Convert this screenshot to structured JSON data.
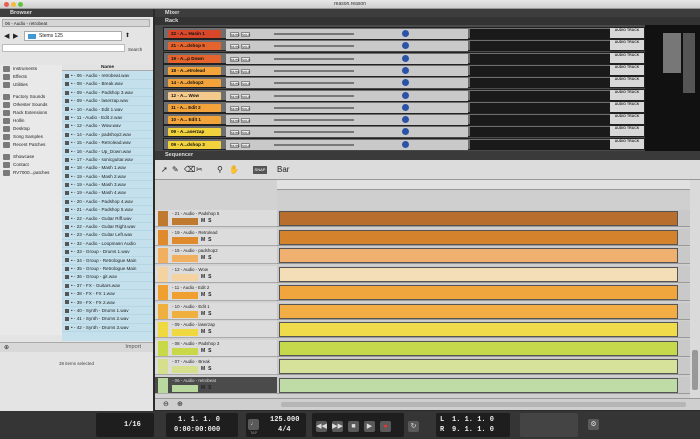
{
  "window": {
    "title": "reason.reason"
  },
  "browser": {
    "header": "Browser",
    "source_path": "06 - Audio - retrobeat",
    "location": "Stems 125",
    "search_label": "Search",
    "list_header": "Name",
    "locations": [
      "Instruments",
      "Effects",
      "Utilities",
      "Factory Sounds",
      "Orkester Sounds",
      "Rack Extensions",
      "Hollin",
      "Desktop",
      "Song Samples",
      "Recent Patches",
      "Showcase",
      "Contact",
      "RV7000...patches"
    ],
    "files": [
      "• - 06 - Audio - retrobeat.wav",
      "• - 08 - Audio - Break.wav",
      "• - 09 - Audio - Padshop 3.wav",
      "• - 09 - Audio - laserzap.wav",
      "• - 10 - Audio - Edit 1.wav",
      "• - 11 - Audio - Edit 2.wav",
      "• - 12 - Audio - Wow.wav",
      "• - 14 - Audio - padshop2.wav",
      "• - 15 - Audio - Retrolead.wav",
      "• - 16 - Audio - Up_Down.wav",
      "• - 17 - Audio - sonicguitar.wav",
      "• - 18 - Audio - Mash 1.wav",
      "• - 19 - Audio - Mash 2.wav",
      "• - 19 - Audio - Mash 3.wav",
      "• - 19 - Audio - Mash 4.wav",
      "• - 20 - Audio - Padshop 4.wav",
      "• - 21 - Audio - Padshop 5.wav",
      "• - 22 - Audio - Guitar Riff.wav",
      "• - 22 - Audio - Guitar Right.wav",
      "• - 23 - Audio - Guitar Left.wav",
      "• - 32 - Audio - Loopmasn Audio",
      "• - 33 - Group - Drums 1.wav",
      "• - 34 - Group - Retrologue Main",
      "• - 35 - Group - Retrologue Main",
      "• - 36 - Group - git.wav",
      "• - 37 - FX - Guitars.wav",
      "• - 38 - FX - FX 1.wav",
      "• - 39 - FX - FX 2.wav",
      "• - 40 - Synth - Drums 1.wav",
      "• - 41 - Synth - Drums 2.wav",
      "• - 42 - Synth - Drums 3.wav"
    ],
    "import_label": "Import",
    "selection_count": "38 items selected"
  },
  "mixer": {
    "header": "Mixer"
  },
  "rack": {
    "header": "Rack",
    "track_tag": "AUDIO TRACK",
    "mute_label": "MUTE",
    "solo_label": "SOLO",
    "rows": [
      {
        "name": "22 - A... Hasin 1",
        "color": "#d9472b"
      },
      {
        "name": "21 - A...dshop 5",
        "color": "#e5632c"
      },
      {
        "name": "19 - A...p Down",
        "color": "#e5632c"
      },
      {
        "name": "18 - A...etrolead",
        "color": "#f2a43a"
      },
      {
        "name": "14 - A...dshop2",
        "color": "#f2a43a"
      },
      {
        "name": "12 - A... Wow",
        "color": "#f4c98c"
      },
      {
        "name": "11 - A... Edit 2",
        "color": "#f2a43a"
      },
      {
        "name": "10 - A... Edit 1",
        "color": "#f2a43a"
      },
      {
        "name": "09 - A...aserzap",
        "color": "#f1d23c"
      },
      {
        "name": "09 - A...dshop 3",
        "color": "#f1d23c"
      }
    ]
  },
  "sequencer": {
    "header": "Sequencer",
    "snap_label": "SNAP",
    "snap_value": "Bar",
    "tracks": [
      {
        "name": "- 21 - Audio - Padshop 5",
        "color": "#c07a30",
        "lane": "#b86e2c"
      },
      {
        "name": "- 19 - Audio - Retrolead",
        "color": "#e08a2e",
        "lane": "#d4832c"
      },
      {
        "name": "- 15 - Audio - padshop2",
        "color": "#f0b060",
        "lane": "#f0b070"
      },
      {
        "name": "- 12 - Audio - Wow",
        "color": "#f4d3a0",
        "lane": "#f3deb8"
      },
      {
        "name": "- 11 - Audio - Edit 2",
        "color": "#f0a030",
        "lane": "#f0a63c"
      },
      {
        "name": "- 10 - Audio - Edit 1",
        "color": "#f0b040",
        "lane": "#f2ae44"
      },
      {
        "name": "- 09 - Audio - laserzap",
        "color": "#efd840",
        "lane": "#f0dc4a"
      },
      {
        "name": "- 08 - Audio - Padshop 3",
        "color": "#c8d848",
        "lane": "#c6d84c"
      },
      {
        "name": "- 07 - Audio - Break",
        "color": "#d6e08c",
        "lane": "#d6e29a"
      },
      {
        "name": "- 06 - Audio - retrobeat",
        "color": "#b8d8a0",
        "lane": "#c0dca6"
      }
    ],
    "mute": "M",
    "solo": "S"
  },
  "transport": {
    "position": "1. 1. 1. 0",
    "time": "0:00:00:000",
    "tempo": "125.000",
    "signature": "4/4",
    "quantize": "1/16",
    "loop_l": "1. 1. 1. 0",
    "loop_r": "9. 1. 1. 0",
    "l_label": "L",
    "r_label": "R",
    "tap_label": "TAP"
  }
}
